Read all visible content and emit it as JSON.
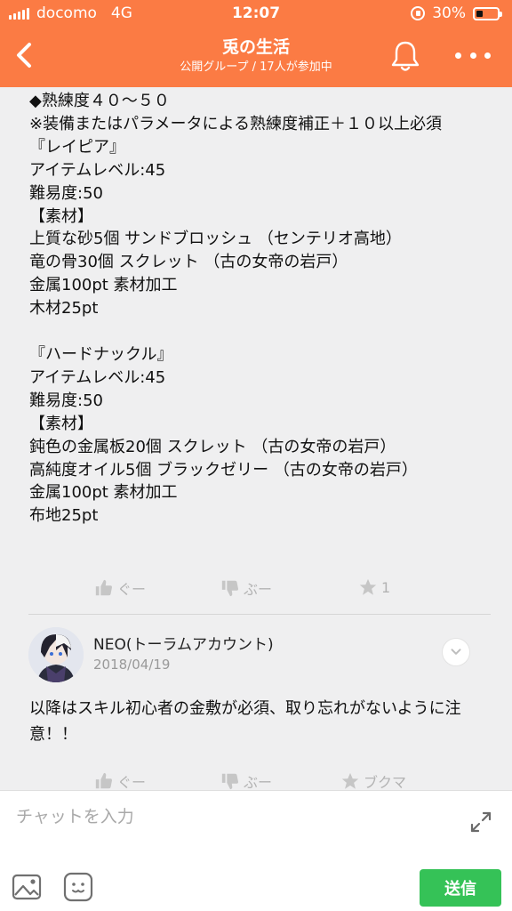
{
  "status_bar": {
    "carrier": "docomo",
    "network": "4G",
    "time": "12:07",
    "battery": "30%",
    "battery_level": 0.3
  },
  "header": {
    "title": "兎の生活",
    "subtitle": "公開グループ / 17人が参加中",
    "accent_color": "#fb7b44"
  },
  "post": {
    "text": "◆熟練度４０～５０\n※装備またはパラメータによる熟練度補正＋１０以上必須\n『レイピア』\nアイテムレベル:45\n難易度:50\n【素材】\n上質な砂5個 サンドブロッシュ （センテリオ高地）\n竜の骨30個 スクレット （古の女帝の岩戸）\n金属100pt 素材加工\n木材25pt\n\n『ハードナックル』\nアイテムレベル:45\n難易度:50\n【素材】\n鈍色の金属板20個 スクレット （古の女帝の岩戸）\n高純度オイル5個 ブラックゼリー （古の女帝の岩戸）\n金属100pt 素材加工\n布地25pt",
    "like_label": "ぐー",
    "dislike_label": "ぶー",
    "star_count": "1"
  },
  "comment": {
    "author": "NEO(トーラムアカウント)",
    "date": "2018/04/19",
    "text": "以降はスキル初心者の金敷が必須、取り忘れがないように注意！！",
    "like_label": "ぐー",
    "dislike_label": "ぶー",
    "bookmark_label": "ブクマ"
  },
  "composer": {
    "placeholder": "チャットを入力",
    "send_label": "送信",
    "send_color": "#35c257"
  }
}
